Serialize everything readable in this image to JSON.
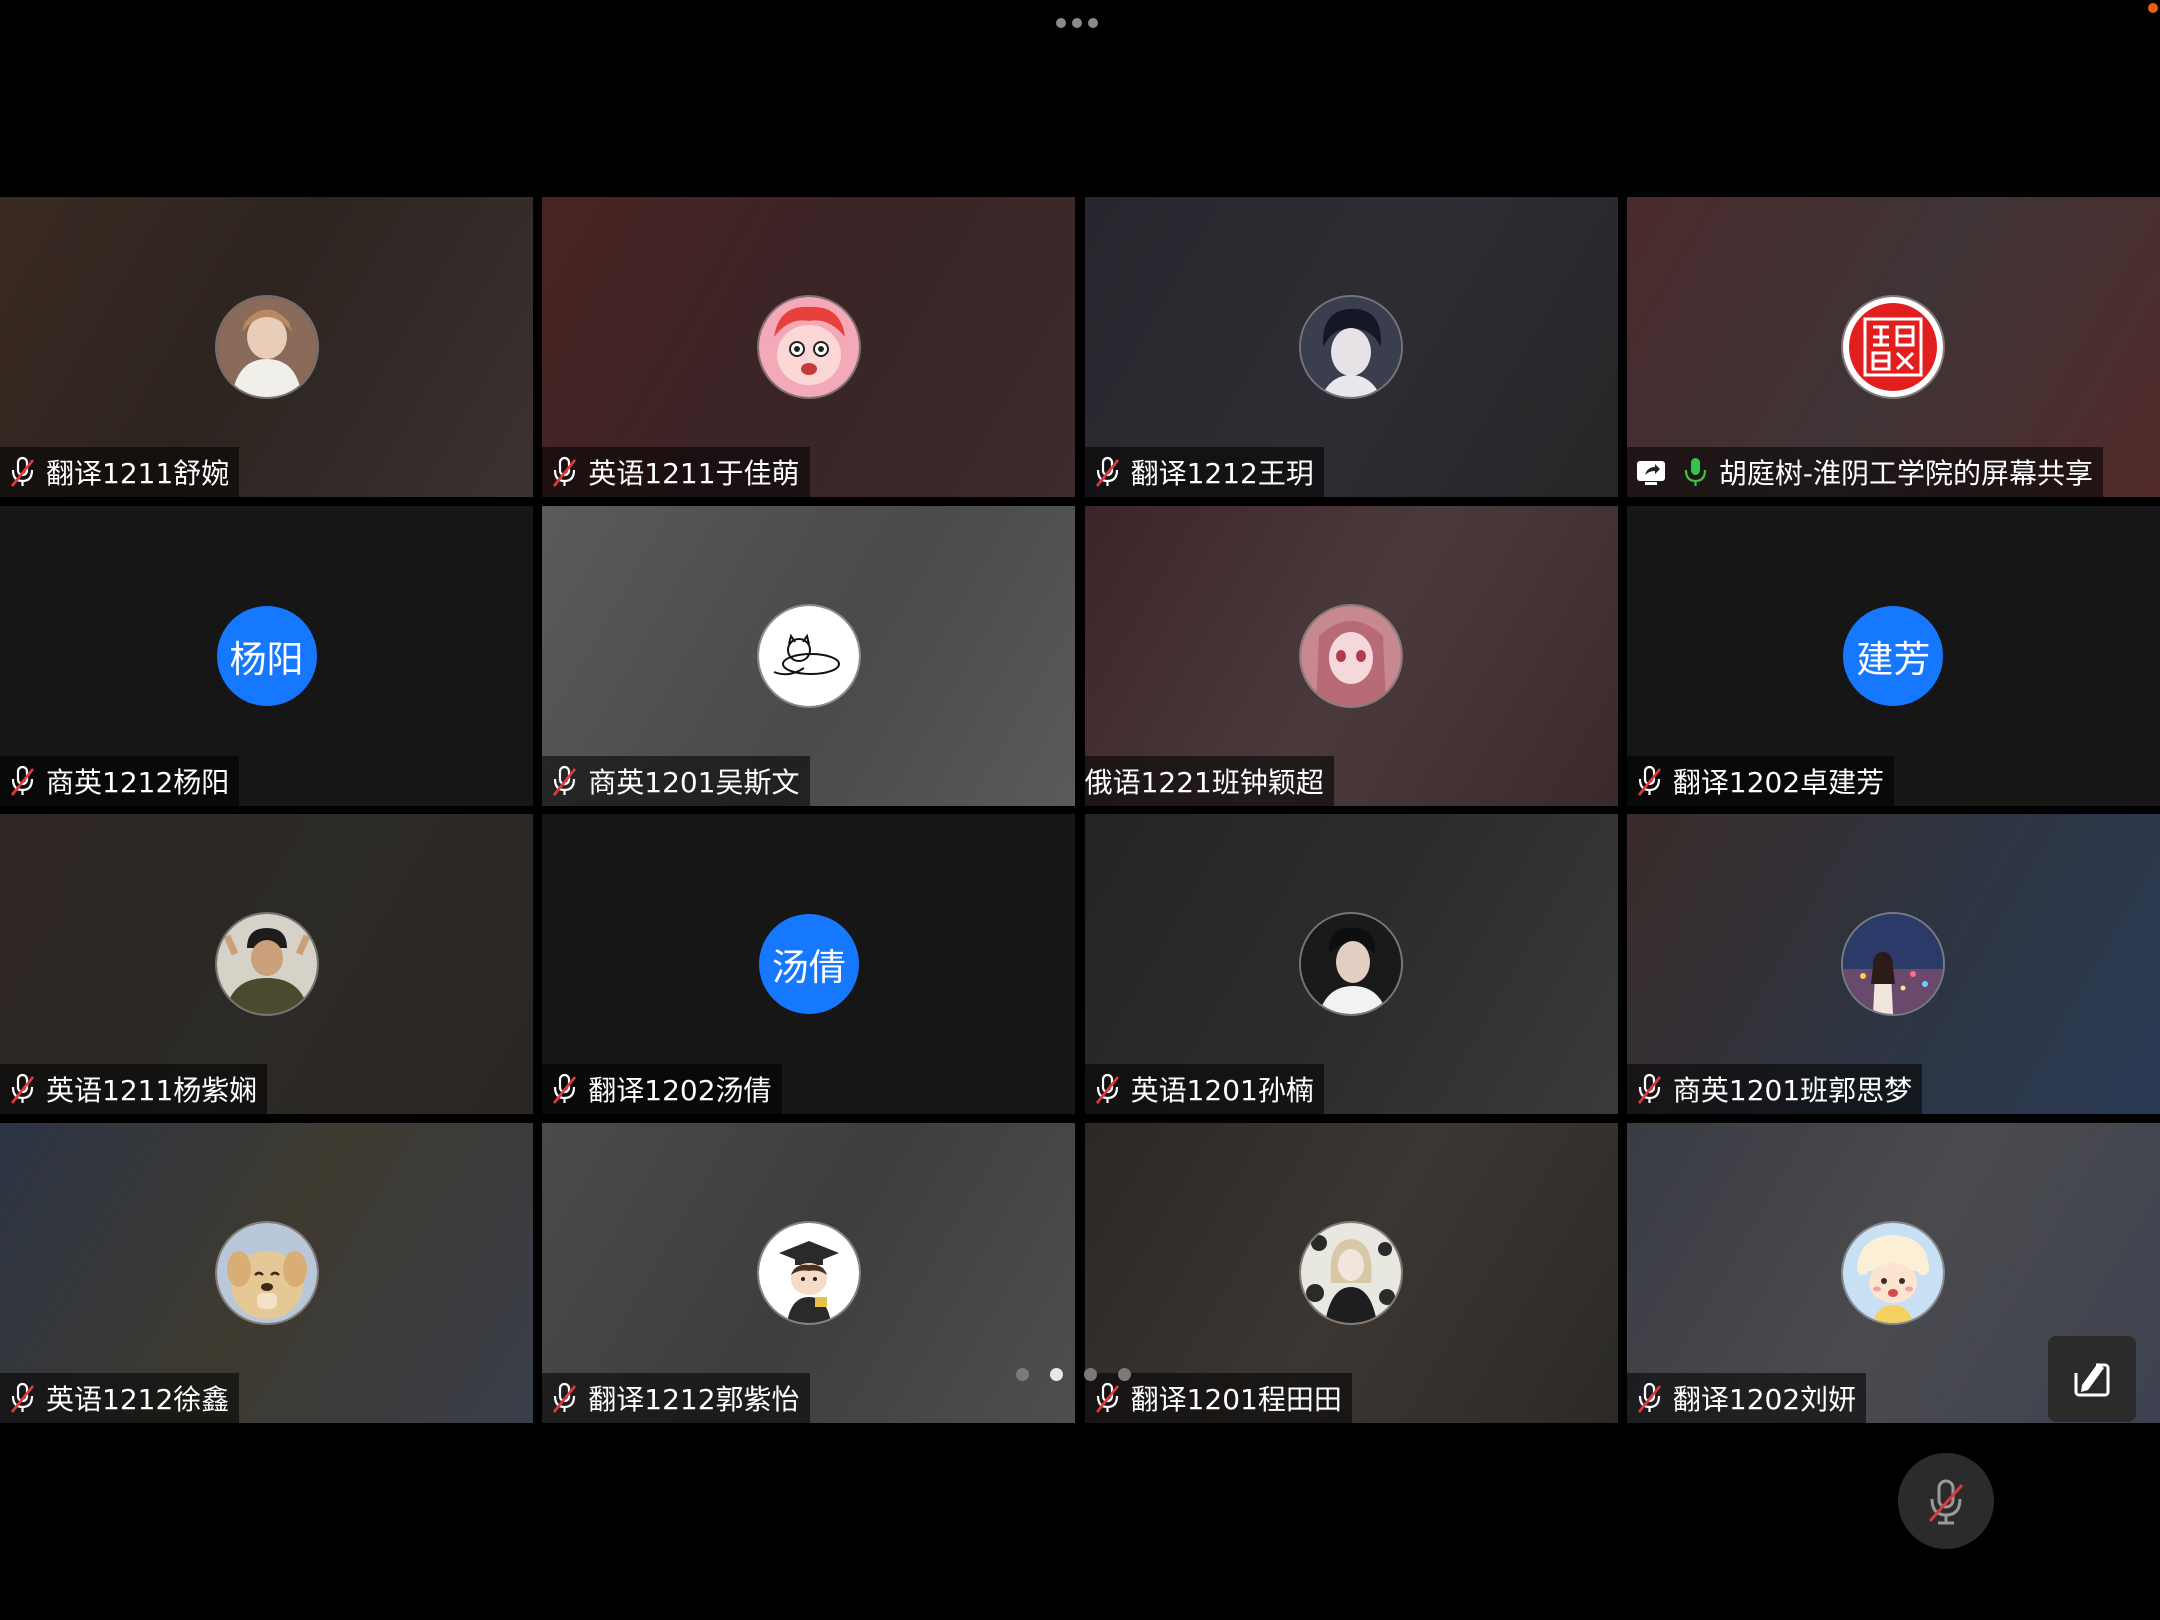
{
  "window": {
    "more_icon": "more-dots-icon",
    "recording_indicator_color": "#e8640c"
  },
  "participants": [
    {
      "name": "翻译1211舒婉",
      "muted": true,
      "avatar": "photo-girl",
      "bg": "linear-gradient(120deg,#3a2a22 0%,#2d2420 45%,#3a3330 100%)"
    },
    {
      "name": "英语1211于佳萌",
      "muted": true,
      "avatar": "cartoon-pink",
      "bg": "linear-gradient(120deg,#4a2424 0%,#3a2426 50%,#3c2c2c 100%)"
    },
    {
      "name": "翻译1212王玥",
      "muted": true,
      "avatar": "anime-boy",
      "bg": "linear-gradient(120deg,#26262e 0%,#2d2d33 50%,#262628 100%)"
    },
    {
      "name": "胡庭树-淮阴工学院的屏幕共享",
      "muted": false,
      "sharing": true,
      "avatar": "red-seal",
      "bg": "linear-gradient(120deg,#4a2a2c 0%,#3f3436 50%,#522a2a 100%)"
    },
    {
      "name": "商英1212杨阳",
      "muted": true,
      "avatar_text": "杨阳",
      "dark": true
    },
    {
      "name": "商英1201吴斯文",
      "muted": true,
      "avatar": "sketch-cat",
      "bg": "linear-gradient(120deg,#5a5a5a 0%,#4a4a4a 55%,#5a5a5a 100%)"
    },
    {
      "name": "俄语1221班钟颖超",
      "muted": false,
      "avatar": "anime-girl-pink",
      "bg": "linear-gradient(120deg,#3e2428 0%,#4a3a3c 50%,#3a2a2c 100%)"
    },
    {
      "name": "翻译1202卓建芳",
      "muted": true,
      "avatar_text": "建芳",
      "dark": true
    },
    {
      "name": "英语1211杨紫娴",
      "muted": true,
      "avatar": "photo-man",
      "bg": "linear-gradient(120deg,#2e2622 0%,#2c2a26 50%,#2a2624 100%)"
    },
    {
      "name": "翻译1202汤倩",
      "muted": true,
      "avatar_text": "汤倩",
      "dark": true
    },
    {
      "name": "英语1201孙楠",
      "muted": true,
      "avatar": "photo-boy",
      "bg": "linear-gradient(120deg,#242424 0%,#2c2c2e 50%,#3a3a3c 100%)"
    },
    {
      "name": "商英1201班郭思梦",
      "muted": true,
      "avatar": "photo-city",
      "bg": "linear-gradient(120deg,#3a2c2a 0%,#2e3440 50%,#2a3a55 100%)"
    },
    {
      "name": "英语1212徐鑫",
      "muted": true,
      "avatar": "photo-dog",
      "bg": "linear-gradient(120deg,#2c3444 0%,#3e3a30 50%,#3a3e4a 100%)"
    },
    {
      "name": "翻译1212郭紫怡",
      "muted": true,
      "avatar": "cartoon-grad",
      "bg": "linear-gradient(120deg,#4a4a4a 0%,#3e3e40 50%,#4e4e4e 100%)"
    },
    {
      "name": "翻译1201程田田",
      "muted": true,
      "avatar": "photo-woman-bw",
      "bg": "linear-gradient(120deg,#2c2826 0%,#3c3632 50%,#2c2a28 100%)"
    },
    {
      "name": "翻译1202刘妍",
      "muted": true,
      "avatar": "cartoon-hat-girl",
      "bg": "linear-gradient(120deg,#3a3c44 0%,#4a4a4e 50%,#3e4250 100%)"
    }
  ],
  "pagination": {
    "pages": 4,
    "current": 2
  },
  "controls": {
    "annotate_icon": "annotate-edit-icon",
    "mute_icon": "mic-muted-icon"
  }
}
